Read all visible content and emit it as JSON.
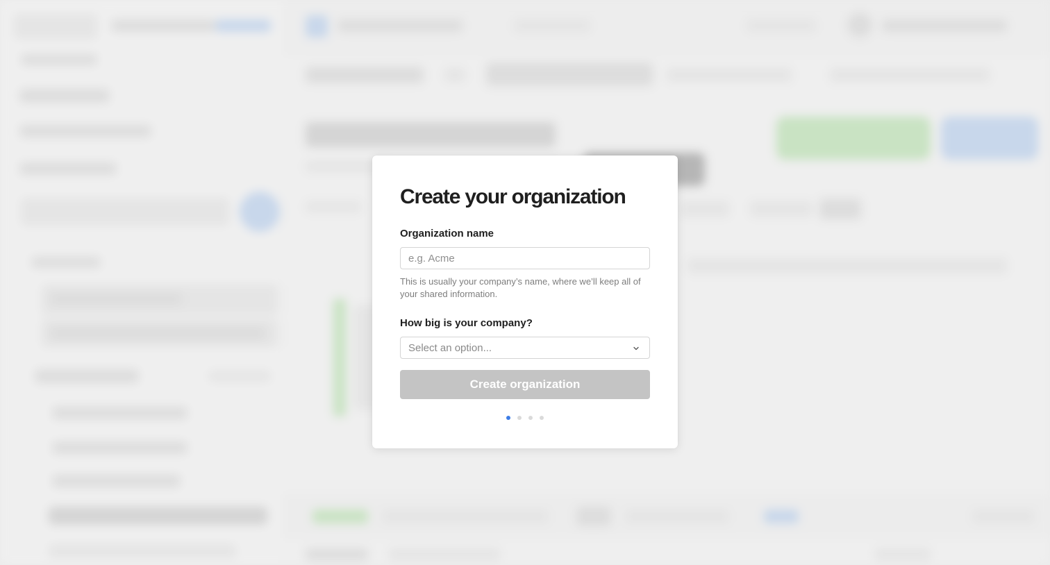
{
  "modal": {
    "title": "Create your organization",
    "org_name_label": "Organization name",
    "org_name_placeholder": "e.g. Acme",
    "org_name_value": "",
    "org_name_hint": "This is usually your company’s name, where we’ll keep all of your shared information.",
    "company_size_label": "How big is your company?",
    "company_size_selected": "Select an option...",
    "submit_label": "Create organization",
    "submit_enabled": false,
    "step_indicator": {
      "total_steps": 4,
      "current_step": 1
    }
  },
  "colors": {
    "accent": "#3d7de6",
    "button_disabled": "#c4c4c4",
    "overlay_background": "#ececec"
  },
  "icons": {
    "select_chevron": "chevron-down-icon"
  }
}
